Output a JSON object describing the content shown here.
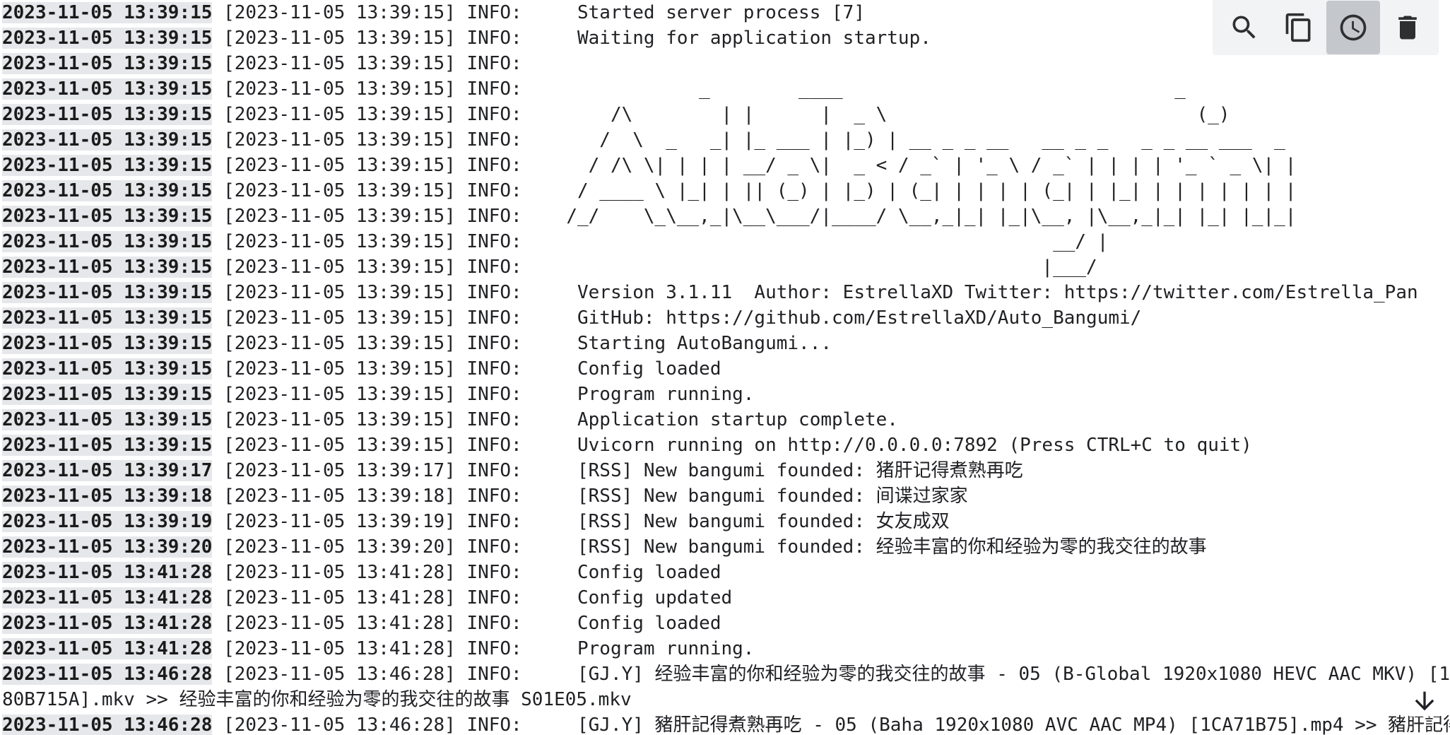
{
  "toolbar": {
    "search_icon": "search-icon",
    "copy_icon": "copy-icon",
    "clock_icon": "clock-icon",
    "delete_icon": "trash-icon"
  },
  "log_lines": [
    {
      "ts": "2023-11-05 13:39:15",
      "body": " [2023-11-05 13:39:15] INFO:     Started server process [7]"
    },
    {
      "ts": "2023-11-05 13:39:15",
      "body": " [2023-11-05 13:39:15] INFO:     Waiting for application startup."
    },
    {
      "ts": "2023-11-05 13:39:15",
      "body": " [2023-11-05 13:39:15] INFO:"
    },
    {
      "ts": "2023-11-05 13:39:15",
      "body": " [2023-11-05 13:39:15] INFO:                _        ____                              _"
    },
    {
      "ts": "2023-11-05 13:39:15",
      "body": " [2023-11-05 13:39:15] INFO:        /\\        | |      |  _ \\                            (_)"
    },
    {
      "ts": "2023-11-05 13:39:15",
      "body": " [2023-11-05 13:39:15] INFO:       /  \\  _   _| |_ ___ | |_) | __ _ _ __   __ _ _   _ _ __ ___  _"
    },
    {
      "ts": "2023-11-05 13:39:15",
      "body": " [2023-11-05 13:39:15] INFO:      / /\\ \\| | | | __/ _ \\|  _ < / _` | '_ \\ / _` | | | | '_ ` _ \\| |"
    },
    {
      "ts": "2023-11-05 13:39:15",
      "body": " [2023-11-05 13:39:15] INFO:     / ____ \\ |_| | || (_) | |_) | (_| | | | | (_| | |_| | | | | | | |"
    },
    {
      "ts": "2023-11-05 13:39:15",
      "body": " [2023-11-05 13:39:15] INFO:    /_/    \\_\\__,_|\\__\\___/|____/ \\__,_|_| |_|\\__, |\\__,_|_| |_| |_|_|"
    },
    {
      "ts": "2023-11-05 13:39:15",
      "body": " [2023-11-05 13:39:15] INFO:                                                __/ |"
    },
    {
      "ts": "2023-11-05 13:39:15",
      "body": " [2023-11-05 13:39:15] INFO:                                               |___/"
    },
    {
      "ts": "2023-11-05 13:39:15",
      "body": " [2023-11-05 13:39:15] INFO:     Version 3.1.11  Author: EstrellaXD Twitter: https://twitter.com/Estrella_Pan"
    },
    {
      "ts": "2023-11-05 13:39:15",
      "body": " [2023-11-05 13:39:15] INFO:     GitHub: https://github.com/EstrellaXD/Auto_Bangumi/"
    },
    {
      "ts": "2023-11-05 13:39:15",
      "body": " [2023-11-05 13:39:15] INFO:     Starting AutoBangumi..."
    },
    {
      "ts": "2023-11-05 13:39:15",
      "body": " [2023-11-05 13:39:15] INFO:     Config loaded"
    },
    {
      "ts": "2023-11-05 13:39:15",
      "body": " [2023-11-05 13:39:15] INFO:     Program running."
    },
    {
      "ts": "2023-11-05 13:39:15",
      "body": " [2023-11-05 13:39:15] INFO:     Application startup complete."
    },
    {
      "ts": "2023-11-05 13:39:15",
      "body": " [2023-11-05 13:39:15] INFO:     Uvicorn running on http://0.0.0.0:7892 (Press CTRL+C to quit)"
    },
    {
      "ts": "2023-11-05 13:39:17",
      "body": " [2023-11-05 13:39:17] INFO:     [RSS] New bangumi founded: 猪肝记得煮熟再吃"
    },
    {
      "ts": "2023-11-05 13:39:18",
      "body": " [2023-11-05 13:39:18] INFO:     [RSS] New bangumi founded: 间谍过家家"
    },
    {
      "ts": "2023-11-05 13:39:19",
      "body": " [2023-11-05 13:39:19] INFO:     [RSS] New bangumi founded: 女友成双"
    },
    {
      "ts": "2023-11-05 13:39:20",
      "body": " [2023-11-05 13:39:20] INFO:     [RSS] New bangumi founded: 经验丰富的你和经验为零的我交往的故事"
    },
    {
      "ts": "2023-11-05 13:41:28",
      "body": " [2023-11-05 13:41:28] INFO:     Config loaded"
    },
    {
      "ts": "2023-11-05 13:41:28",
      "body": " [2023-11-05 13:41:28] INFO:     Config updated"
    },
    {
      "ts": "2023-11-05 13:41:28",
      "body": " [2023-11-05 13:41:28] INFO:     Config loaded"
    },
    {
      "ts": "2023-11-05 13:41:28",
      "body": " [2023-11-05 13:41:28] INFO:     Program running."
    },
    {
      "ts": "2023-11-05 13:46:28",
      "body": " [2023-11-05 13:46:28] INFO:     [GJ.Y] 经验丰富的你和经验为零的我交往的故事 - 05 (B-Global 1920x1080 HEVC AAC MKV) [1"
    },
    {
      "ts": "",
      "body": "80B715A].mkv >> 经验丰富的你和经验为零的我交往的故事 S01E05.mkv"
    },
    {
      "ts": "2023-11-05 13:46:28",
      "body": " [2023-11-05 13:46:28] INFO:     [GJ.Y] 豬肝記得煮熟再吃 - 05 (Baha 1920x1080 AVC AAC MP4) [1CA71B75].mp4 >> 豬肝記得"
    }
  ]
}
